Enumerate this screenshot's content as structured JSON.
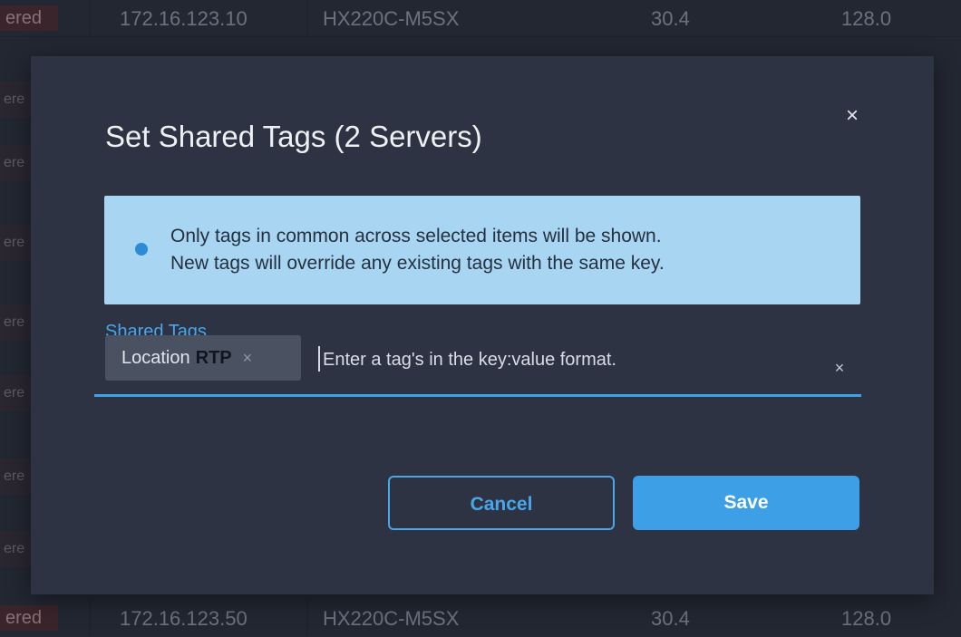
{
  "background_table": {
    "rows": [
      {
        "status": "ered",
        "ip": "172.16.123.10",
        "model": "HX220C-M5SX",
        "col3": "30.4",
        "col4": "128.0"
      },
      {
        "status": "ered",
        "ip": "172.16.123.50",
        "model": "HX220C-M5SX",
        "col3": "30.4",
        "col4": "128.0"
      }
    ],
    "side_status": [
      "ere",
      "ere",
      "ere",
      "ere",
      "ere",
      "ere",
      "ere"
    ]
  },
  "dialog": {
    "title": "Set Shared Tags (2 Servers)",
    "close_symbol": "×",
    "info": {
      "icon": "info-icon",
      "line1": "Only tags in common across selected items will be shown.",
      "line2": "New tags will override any existing tags with the same key."
    },
    "field_label": "Shared Tags",
    "tags": [
      {
        "key": "Location",
        "value": "RTP",
        "remove_symbol": "×"
      }
    ],
    "input_placeholder": "Enter a tag's in the key:value format.",
    "clear_symbol": "×",
    "cancel_label": "Cancel",
    "save_label": "Save"
  },
  "colors": {
    "accent": "#3ea2e6",
    "info_background": "#a8d6f2",
    "dialog_background": "#2d3343"
  }
}
